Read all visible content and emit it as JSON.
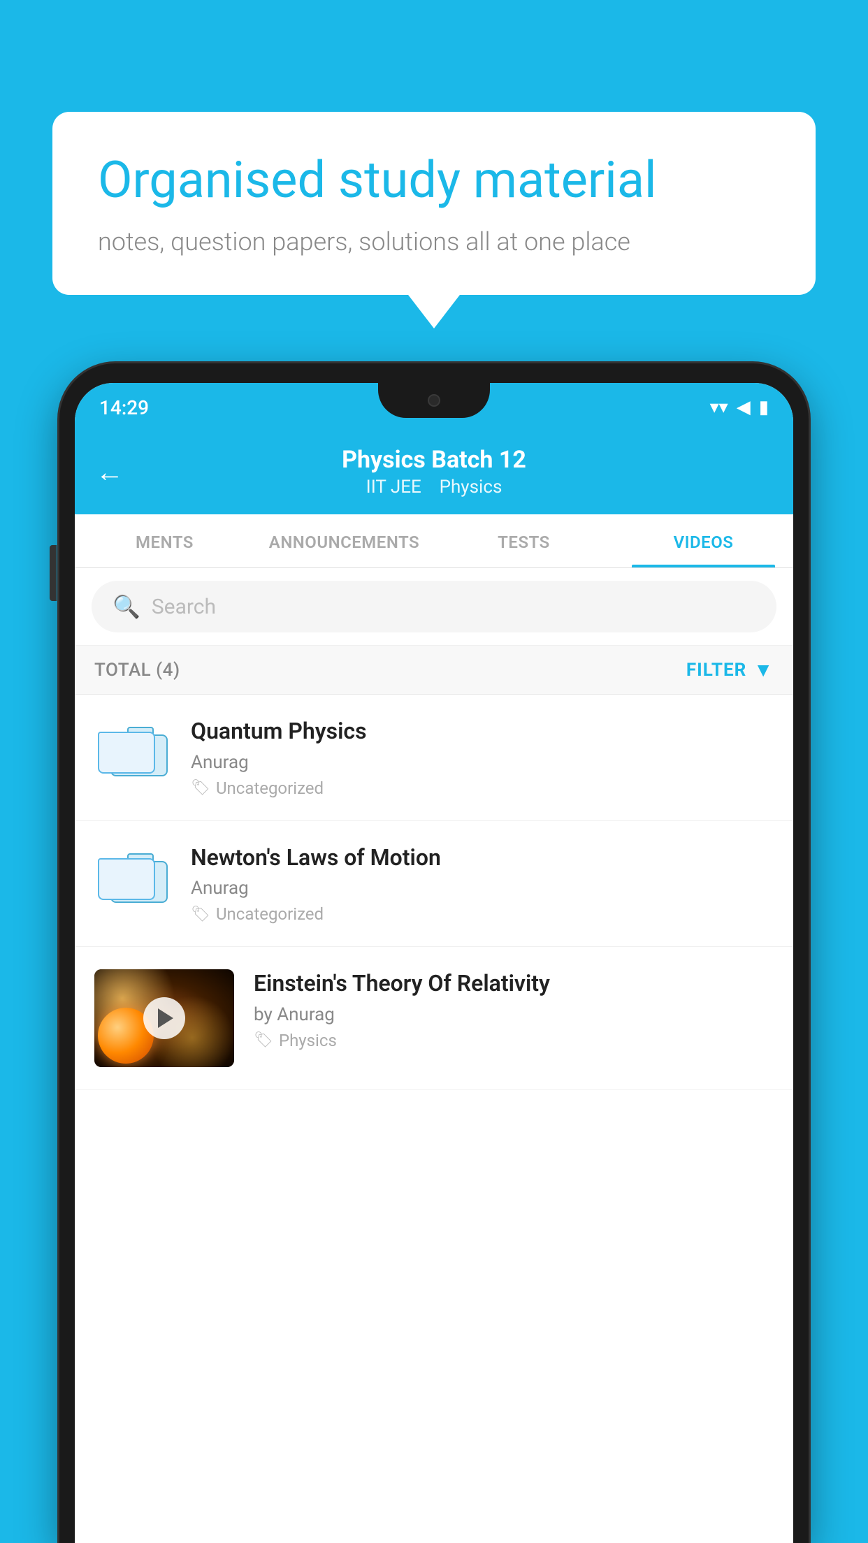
{
  "background": {
    "color": "#1bb8e8"
  },
  "speech_bubble": {
    "heading": "Organised study material",
    "subtext": "notes, question papers, solutions all at one place"
  },
  "phone": {
    "status_bar": {
      "time": "14:29",
      "wifi_icon": "wifi",
      "signal_icon": "signal",
      "battery_icon": "battery"
    },
    "nav": {
      "back_label": "←",
      "title": "Physics Batch 12",
      "subtitle_tag1": "IIT JEE",
      "subtitle_tag2": "Physics"
    },
    "tabs": [
      {
        "label": "MENTS",
        "active": false
      },
      {
        "label": "ANNOUNCEMENTS",
        "active": false
      },
      {
        "label": "TESTS",
        "active": false
      },
      {
        "label": "VIDEOS",
        "active": true
      }
    ],
    "search": {
      "placeholder": "Search"
    },
    "filter_row": {
      "total_label": "TOTAL (4)",
      "filter_label": "FILTER"
    },
    "videos": [
      {
        "id": "quantum",
        "title": "Quantum Physics",
        "author": "Anurag",
        "tag": "Uncategorized",
        "has_image": false
      },
      {
        "id": "newton",
        "title": "Newton's Laws of Motion",
        "author": "Anurag",
        "tag": "Uncategorized",
        "has_image": false
      },
      {
        "id": "einstein",
        "title": "Einstein's Theory Of Relativity",
        "author": "by Anurag",
        "tag": "Physics",
        "has_image": true
      }
    ]
  }
}
